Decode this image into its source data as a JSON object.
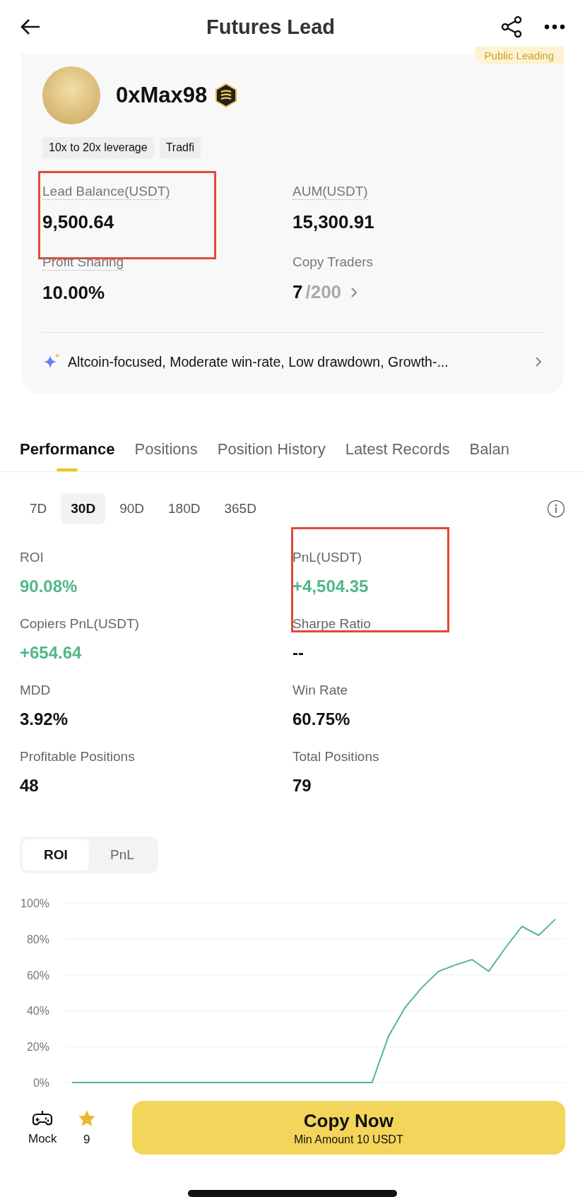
{
  "header": {
    "title": "Futures Lead"
  },
  "profile": {
    "badge": "Public Leading",
    "name": "0xMax98",
    "tags": [
      "10x to 20x leverage",
      "Tradfi"
    ],
    "stats": [
      {
        "kind": "plain",
        "label": "Lead Balance(USDT)",
        "value": "9,500.64",
        "dotted": true,
        "highlighted": true
      },
      {
        "kind": "plain",
        "label": "AUM(USDT)",
        "value": "15,300.91",
        "dotted": true,
        "highlighted": false
      },
      {
        "kind": "plain",
        "label": "Profit Sharing",
        "value": "10.00%",
        "dotted": true,
        "highlighted": false
      },
      {
        "kind": "fraction",
        "label": "Copy Traders",
        "value": "7",
        "total": "/200",
        "dotted": false,
        "highlighted": false
      }
    ],
    "summary": "Altcoin-focused, Moderate win-rate, Low drawdown, Growth-..."
  },
  "tabs": [
    {
      "label": "Performance",
      "selected": true
    },
    {
      "label": "Positions",
      "selected": false
    },
    {
      "label": "Position History",
      "selected": false
    },
    {
      "label": "Latest Records",
      "selected": false
    },
    {
      "label": "Balan",
      "selected": false
    }
  ],
  "periods": [
    {
      "label": "7D",
      "selected": false
    },
    {
      "label": "30D",
      "selected": true
    },
    {
      "label": "90D",
      "selected": false
    },
    {
      "label": "180D",
      "selected": false
    },
    {
      "label": "365D",
      "selected": false
    }
  ],
  "metrics": [
    {
      "label": "ROI",
      "value": "90.08%",
      "positive": true,
      "highlighted": false
    },
    {
      "label": "PnL(USDT)",
      "value": "+4,504.35",
      "positive": true,
      "highlighted": true
    },
    {
      "label": "Copiers PnL(USDT)",
      "value": "+654.64",
      "positive": true,
      "highlighted": false
    },
    {
      "label": "Sharpe Ratio",
      "value": "--",
      "positive": false,
      "highlighted": false
    },
    {
      "label": "MDD",
      "value": "3.92%",
      "positive": false,
      "highlighted": false
    },
    {
      "label": "Win Rate",
      "value": "60.75%",
      "positive": false,
      "highlighted": false
    },
    {
      "label": "Profitable Positions",
      "value": "48",
      "positive": false,
      "highlighted": false
    },
    {
      "label": "Total Positions",
      "value": "79",
      "positive": false,
      "highlighted": false
    }
  ],
  "chart_toggle": [
    {
      "label": "ROI",
      "selected": true
    },
    {
      "label": "PnL",
      "selected": false
    }
  ],
  "chart_data": {
    "type": "line",
    "grid": true,
    "ylim": [
      0,
      100
    ],
    "yticks": [
      {
        "value": 0,
        "label": "0%"
      },
      {
        "value": 20,
        "label": "20%"
      },
      {
        "value": 40,
        "label": "40%"
      },
      {
        "value": 60,
        "label": "60%"
      },
      {
        "value": 80,
        "label": "80%"
      },
      {
        "value": 100,
        "label": "100%"
      }
    ],
    "series": [
      {
        "color": "#52b788",
        "values": [
          0,
          0,
          0,
          0,
          0,
          0,
          0,
          0,
          0,
          0,
          0,
          0,
          0,
          0,
          0,
          0,
          0,
          0,
          0,
          26,
          42,
          53,
          62,
          65.5,
          68.5,
          62,
          75,
          87,
          82,
          91
        ]
      }
    ]
  },
  "bottom_bar": {
    "mock_label": "Mock",
    "favorites": "9",
    "button": {
      "title": "Copy Now",
      "subtitle": "Min Amount 10 USDT"
    }
  }
}
